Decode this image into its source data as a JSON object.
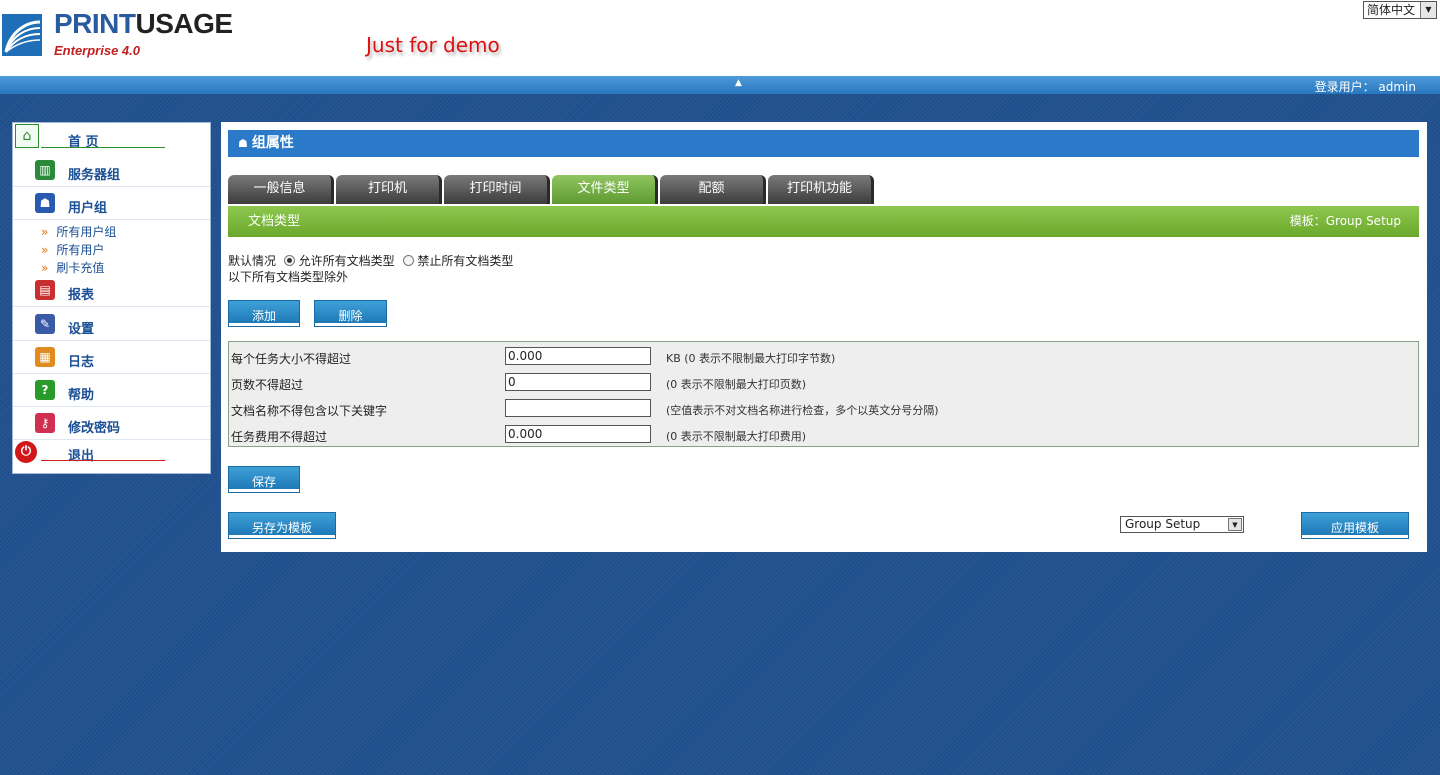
{
  "header": {
    "logo_name_part1": "PRINT",
    "logo_name_part2": "USAGE",
    "logo_edition": "Enterprise 4.0",
    "demo_note": "Just for demo",
    "language_selected": "简体中文"
  },
  "topbar": {
    "logged_in_user": "登录用户：  admin"
  },
  "sidebar": {
    "home": "首 页",
    "server_group": "服务器组",
    "user_group": "用户组",
    "user_group_subitems": [
      "所有用户组",
      "所有用户",
      "刷卡充值"
    ],
    "reports": "报表",
    "settings": "设置",
    "logs": "日志",
    "help": "帮助",
    "change_password": "修改密码",
    "logout": "退出"
  },
  "main": {
    "page_title": "组属性",
    "tabs": [
      "一般信息",
      "打印机",
      "打印时间",
      "文件类型",
      "配额",
      "打印机功能"
    ],
    "active_tab": "文件类型",
    "section_title": "文档类型",
    "template_label": "模板：Group Setup",
    "default_label": "默认情况",
    "radio_allow": "允许所有文档类型",
    "radio_deny": "禁止所有文档类型",
    "radio_selected": "allow",
    "except_text": "以下所有文档类型除外",
    "add_button": "添加",
    "delete_button": "删除",
    "form_rows": [
      {
        "label": "每个任务大小不得超过",
        "value": "0.000",
        "hint": "KB (0 表示不限制最大打印字节数)"
      },
      {
        "label": "页数不得超过",
        "value": "0",
        "hint": "(0 表示不限制最大打印页数)"
      },
      {
        "label": "文档名称不得包含以下关键字",
        "value": "",
        "hint": "(空值表示不对文档名称进行检查，多个以英文分号分隔)"
      },
      {
        "label": "任务费用不得超过",
        "value": "0.000",
        "hint": "(0 表示不限制最大打印费用)"
      }
    ],
    "save_button": "保存",
    "save_as_template_button": "另存为模板",
    "template_select_value": "Group Setup",
    "apply_template_button": "应用模板"
  },
  "colors": {
    "brand_blue": "#2a7ac9",
    "active_tab_green": "#6aa82c",
    "background_blue": "#1f4f8c",
    "demo_red": "#e01010"
  }
}
